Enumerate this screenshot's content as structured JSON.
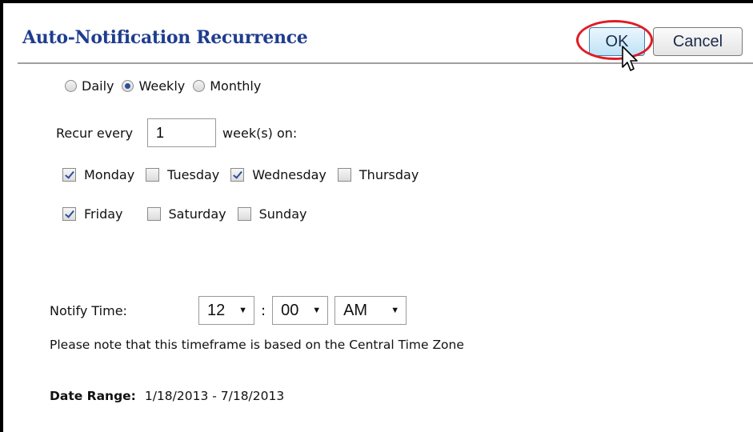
{
  "dialog": {
    "title": "Auto-Notification Recurrence",
    "ok_label": "OK",
    "cancel_label": "Cancel"
  },
  "frequency": {
    "options": [
      "Daily",
      "Weekly",
      "Monthly"
    ],
    "selected": "Weekly"
  },
  "recur": {
    "prefix": "Recur every",
    "value": "1",
    "suffix": "week(s) on:"
  },
  "days": [
    {
      "label": "Monday",
      "checked": true
    },
    {
      "label": "Tuesday",
      "checked": false
    },
    {
      "label": "Wednesday",
      "checked": true
    },
    {
      "label": "Thursday",
      "checked": false
    },
    {
      "label": "Friday",
      "checked": true
    },
    {
      "label": "Saturday",
      "checked": false
    },
    {
      "label": "Sunday",
      "checked": false
    }
  ],
  "notify": {
    "label": "Notify Time:",
    "hour": "12",
    "minute": "00",
    "ampm": "AM",
    "separator": ":"
  },
  "note": "Please note that this timeframe is based on the Central Time Zone",
  "date_range": {
    "label": "Date Range:",
    "value": "1/18/2013 - 7/18/2013"
  },
  "colors": {
    "title": "#1f3d8f",
    "highlight": "#e01b24",
    "check": "#2b4f9c"
  },
  "icons": {
    "cursor": "arrow-cursor-icon",
    "caret": "caret-down-icon"
  }
}
